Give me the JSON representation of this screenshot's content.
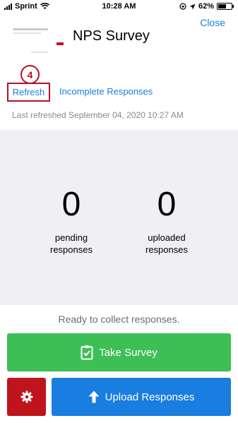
{
  "status_bar": {
    "carrier": "Sprint",
    "time": "10:28 AM",
    "battery_percent": "62%",
    "battery_level": 0.62,
    "icons": [
      "signal-icon",
      "wifi-icon",
      "orientation-lock-icon",
      "location-icon",
      "battery-icon"
    ]
  },
  "header": {
    "title": "NPS Survey",
    "close_label": "Close"
  },
  "tabs": {
    "refresh_label": "Refresh",
    "incomplete_label": "Incomplete Responses",
    "step_marker": "4"
  },
  "last_refreshed": "Last refreshed September 04, 2020 10:27 AM",
  "stats": {
    "pending_count": "0",
    "pending_label_line1": "pending",
    "pending_label_line2": "responses",
    "uploaded_count": "0",
    "uploaded_label_line1": "uploaded",
    "uploaded_label_line2": "responses"
  },
  "status_message": "Ready to collect responses.",
  "actions": {
    "take_survey_label": "Take Survey",
    "upload_label": "Upload Responses",
    "settings_icon": "gear-icon"
  },
  "colors": {
    "link": "#1a7de0",
    "take_survey": "#3dbf55",
    "upload": "#1a7de0",
    "settings": "#c0141c",
    "highlight": "#b5112a"
  }
}
